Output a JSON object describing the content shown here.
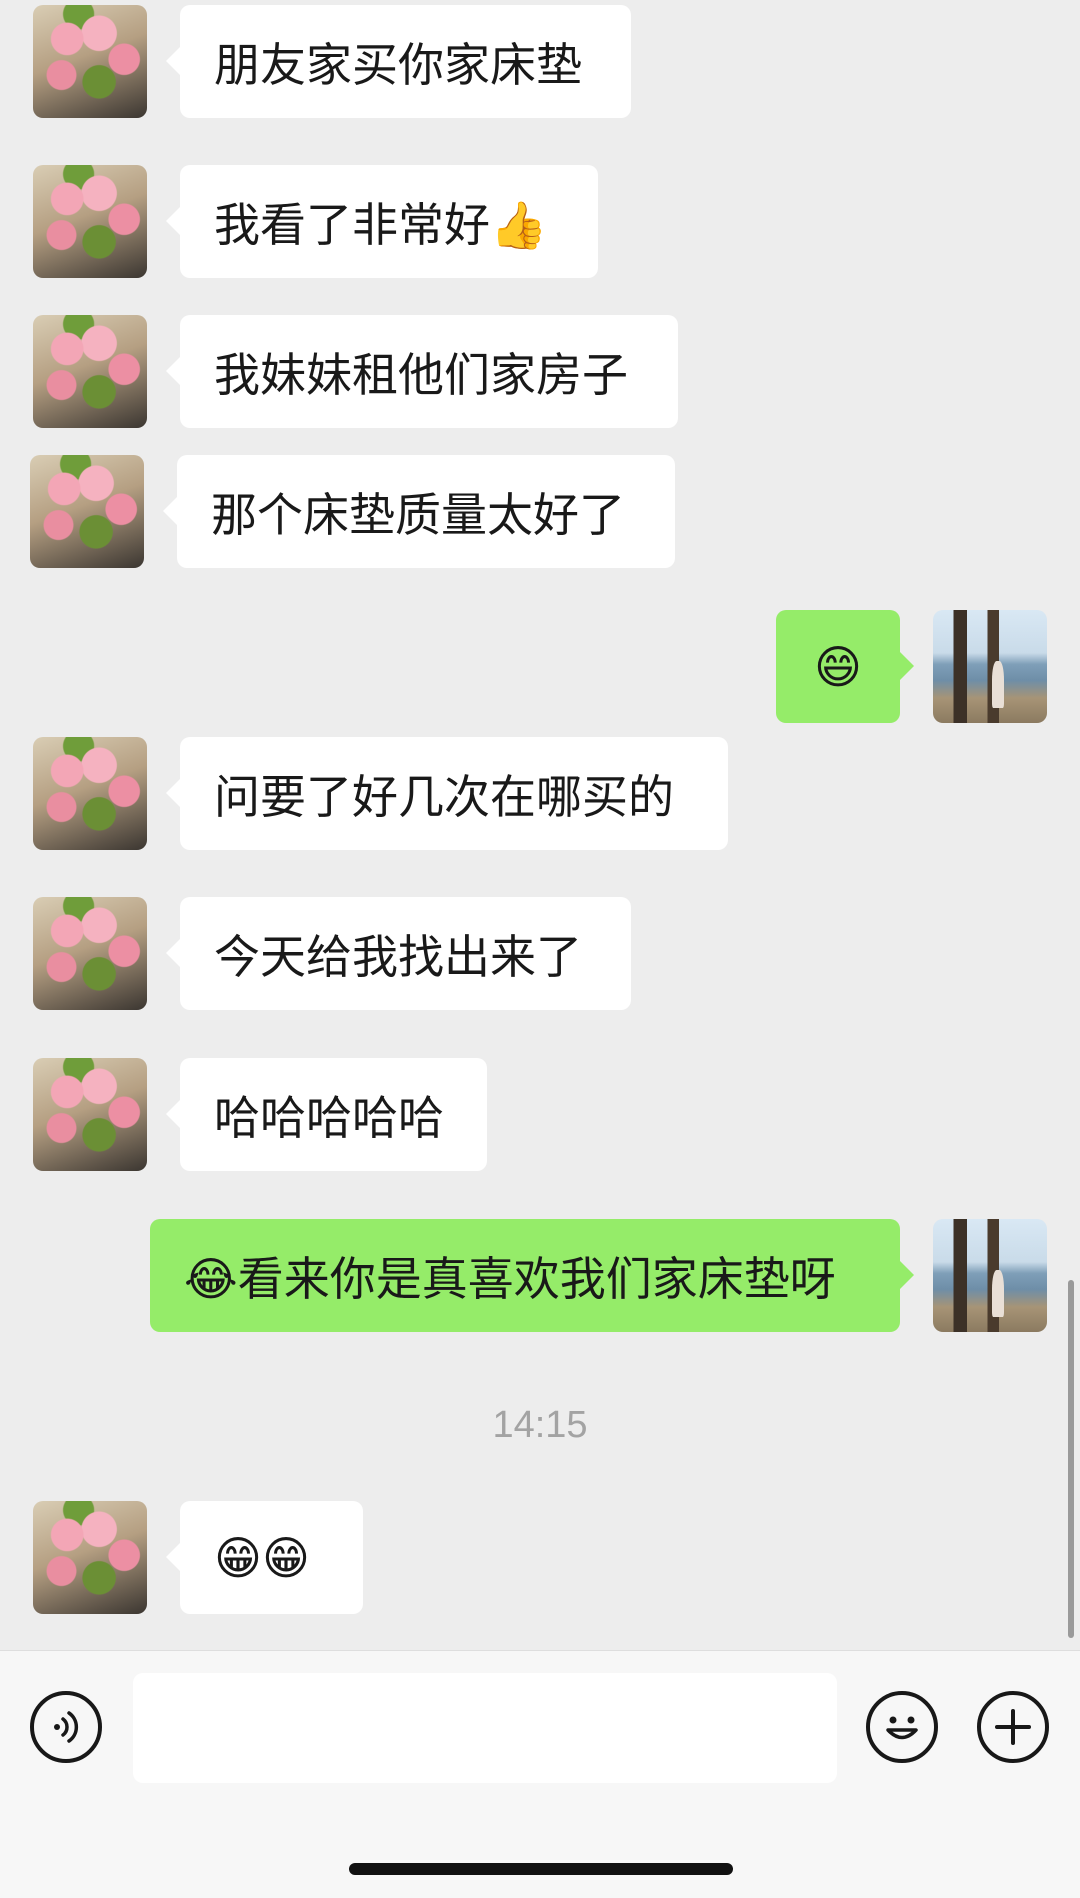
{
  "messages": [
    {
      "side": "in",
      "text": "朋友家买你家床垫"
    },
    {
      "side": "in",
      "text": "我看了非常好👍"
    },
    {
      "side": "in",
      "text": "我妹妹租他们家房子"
    },
    {
      "side": "in",
      "text": "那个床垫质量太好了"
    },
    {
      "side": "out",
      "text": "😄"
    },
    {
      "side": "in",
      "text": "问要了好几次在哪买的"
    },
    {
      "side": "in",
      "text": "今天给我找出来了"
    },
    {
      "side": "in",
      "text": "哈哈哈哈哈"
    },
    {
      "side": "out",
      "text": "😂看来你是真喜欢我们家床垫呀"
    },
    {
      "side": "in",
      "text": "😁😁"
    }
  ],
  "timestamp": "14:15",
  "input": {
    "value": "",
    "placeholder": ""
  },
  "icons": {
    "voice": "voice-icon",
    "emoji": "emoji-icon",
    "plus": "plus-icon"
  },
  "colors": {
    "background": "#ededed",
    "incoming_bubble": "#ffffff",
    "outgoing_bubble": "#95ec69",
    "timestamp": "#a3a3a3"
  }
}
